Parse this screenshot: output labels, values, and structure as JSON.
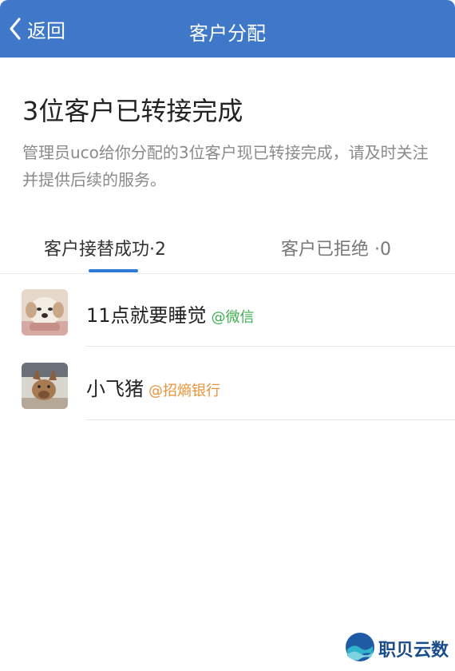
{
  "nav": {
    "back_label": "返回",
    "title": "客户分配"
  },
  "main": {
    "heading": "3位客户已转接完成",
    "description": "管理员uco给你分配的3位客户现已转接完成，请及时关注并提供后续的服务。"
  },
  "tabs": [
    {
      "label": "客户接替成功·2",
      "active": true
    },
    {
      "label": "客户已拒绝 ·0",
      "active": false
    }
  ],
  "customers": [
    {
      "name": "11点就要睡觉",
      "tag": "@微信",
      "tag_color": "#3fae52",
      "avatar": "puppy-avatar"
    },
    {
      "name": "小飞猪",
      "tag": "@招熵银行",
      "tag_color": "#e89438",
      "avatar": "pig-toy-avatar"
    }
  ],
  "watermark": {
    "text": "职贝云数"
  },
  "colors": {
    "nav_bg": "#3f78c9",
    "tab_underline": "#2f7ad6"
  }
}
